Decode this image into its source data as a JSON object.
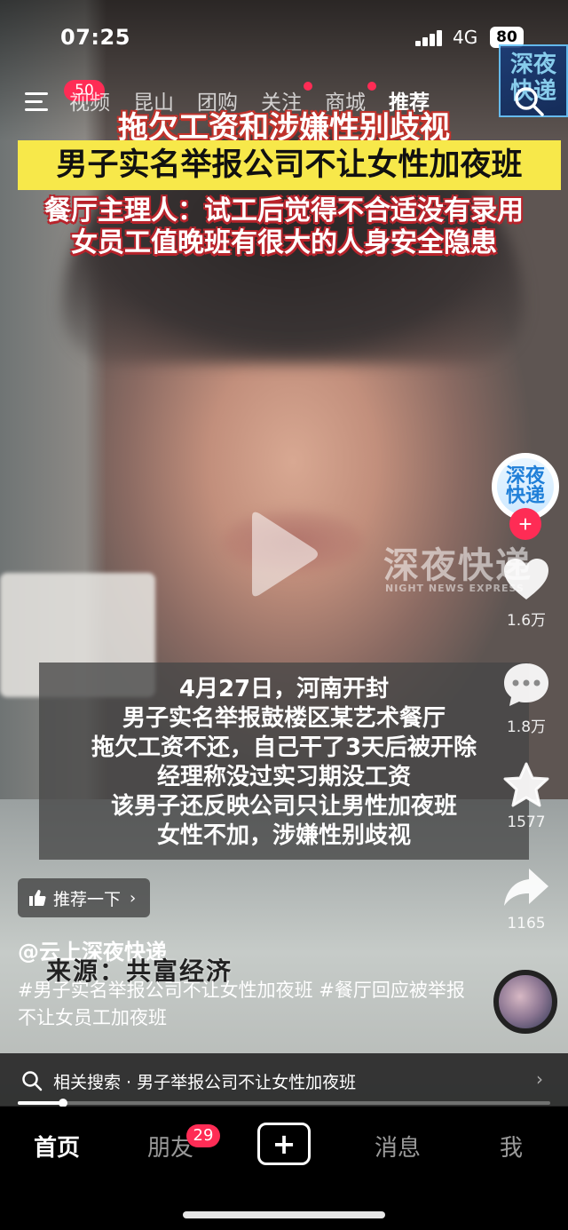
{
  "status_bar": {
    "time": "07:25",
    "network": "4G",
    "battery": "80"
  },
  "top_nav": {
    "menu_badge": "50",
    "tabs": [
      {
        "label": "视频",
        "dot": false
      },
      {
        "label": "昆山",
        "dot": false
      },
      {
        "label": "团购",
        "dot": false
      },
      {
        "label": "关注",
        "dot": true
      },
      {
        "label": "商城",
        "dot": true
      },
      {
        "label": "推荐",
        "dot": false,
        "active": true
      }
    ]
  },
  "channel_watermark": {
    "line1": "深夜",
    "line2": "快递"
  },
  "headline": {
    "line1": "拖欠工资和涉嫌性别歧视",
    "line2": "男子实名举报公司不让女性加夜班",
    "line3a": "餐厅主理人：试工后觉得不合适没有录用",
    "line3b": "女员工值晚班有很大的人身安全隐患"
  },
  "video_watermark": {
    "main": "深夜快递",
    "sub": "NIGHT NEWS EXPRESS"
  },
  "subtitle": {
    "lines": [
      "4月27日，河南开封",
      "男子实名举报鼓楼区某艺术餐厅",
      "拖欠工资不还，自己干了3天后被开除",
      "经理称没过实习期没工资",
      "该男子还反映公司只让男性加夜班",
      "女性不加，涉嫌性别歧视"
    ]
  },
  "right_rail": {
    "avatar_text1": "深夜",
    "avatar_text2": "快递",
    "likes": "1.6万",
    "comments": "1.8万",
    "favorites": "1577",
    "shares": "1165"
  },
  "recommend": {
    "label": "推荐一下"
  },
  "post": {
    "author": "@云上深夜快递",
    "source_overlay": "来源：共富经济",
    "description": "#男子实名举报公司不让女性加夜班 #餐厅回应被举报不让女员工加夜班"
  },
  "related_search": {
    "label": "相关搜索 · 男子举报公司不让女性加夜班"
  },
  "progress": {
    "fraction": 0.085
  },
  "bottom_nav": {
    "home": "首页",
    "friends": "朋友",
    "friends_badge": "29",
    "create": "+",
    "messages": "消息",
    "me": "我"
  },
  "colors": {
    "accent": "#fe2c55",
    "headline_yellow": "#f7e84a",
    "headline_red": "#c0322b"
  }
}
